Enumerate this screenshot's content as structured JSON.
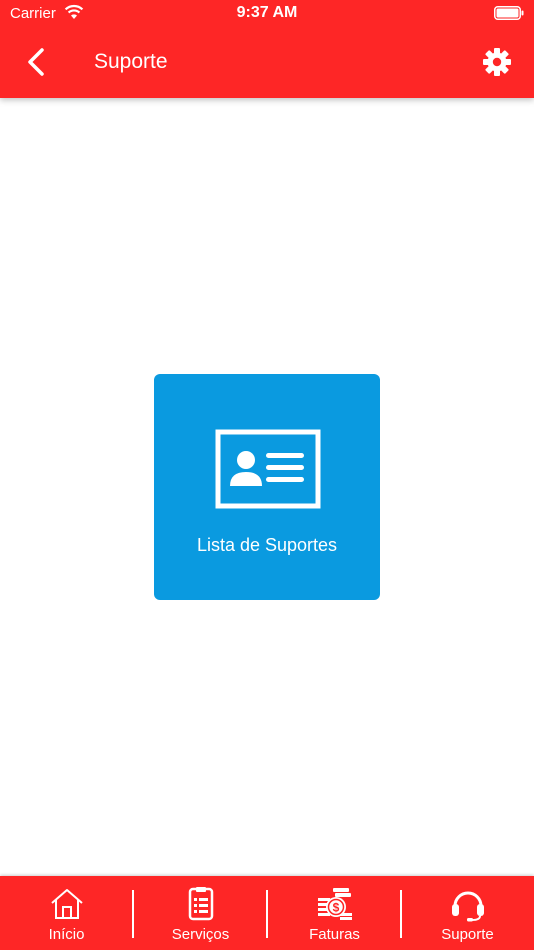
{
  "status_bar": {
    "carrier": "Carrier",
    "time": "9:37 AM"
  },
  "header": {
    "title": "Suporte",
    "back_icon": "chevron-left-icon",
    "settings_icon": "gear-icon"
  },
  "main": {
    "tile": {
      "label": "Lista de Suportes",
      "icon": "id-card-icon",
      "color": "#0a9ae0"
    }
  },
  "tabbar": {
    "items": [
      {
        "label": "Início",
        "icon": "home-icon"
      },
      {
        "label": "Serviços",
        "icon": "document-list-icon"
      },
      {
        "label": "Faturas",
        "icon": "money-bills-icon"
      },
      {
        "label": "Suporte",
        "icon": "headset-icon"
      }
    ]
  },
  "colors": {
    "brand": "#fe2626",
    "tile": "#0a9ae0",
    "text_on_brand": "#ffffff"
  }
}
